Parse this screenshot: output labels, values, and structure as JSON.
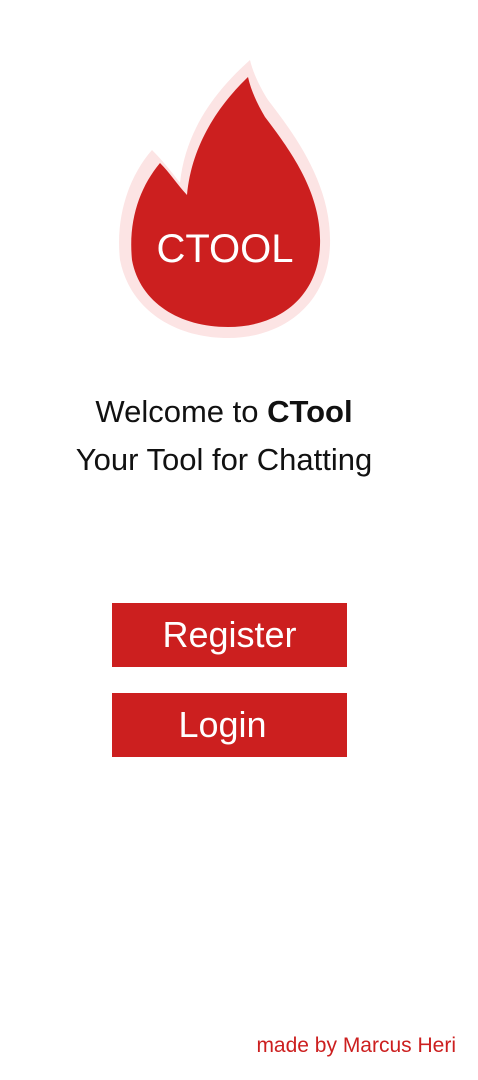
{
  "app": {
    "logo_text": "CTOOL",
    "brand_color": "#cc1f1f",
    "brand_glow_color": "#fce4e4"
  },
  "welcome": {
    "line1_prefix": "Welcome to ",
    "line1_brand": "CTool",
    "line2": "Your Tool for Chatting"
  },
  "actions": {
    "register_label": "Register",
    "login_label": "Login"
  },
  "footer": {
    "credit": "made by Marcus Heri"
  },
  "icons": {
    "logo": "flame-icon"
  }
}
